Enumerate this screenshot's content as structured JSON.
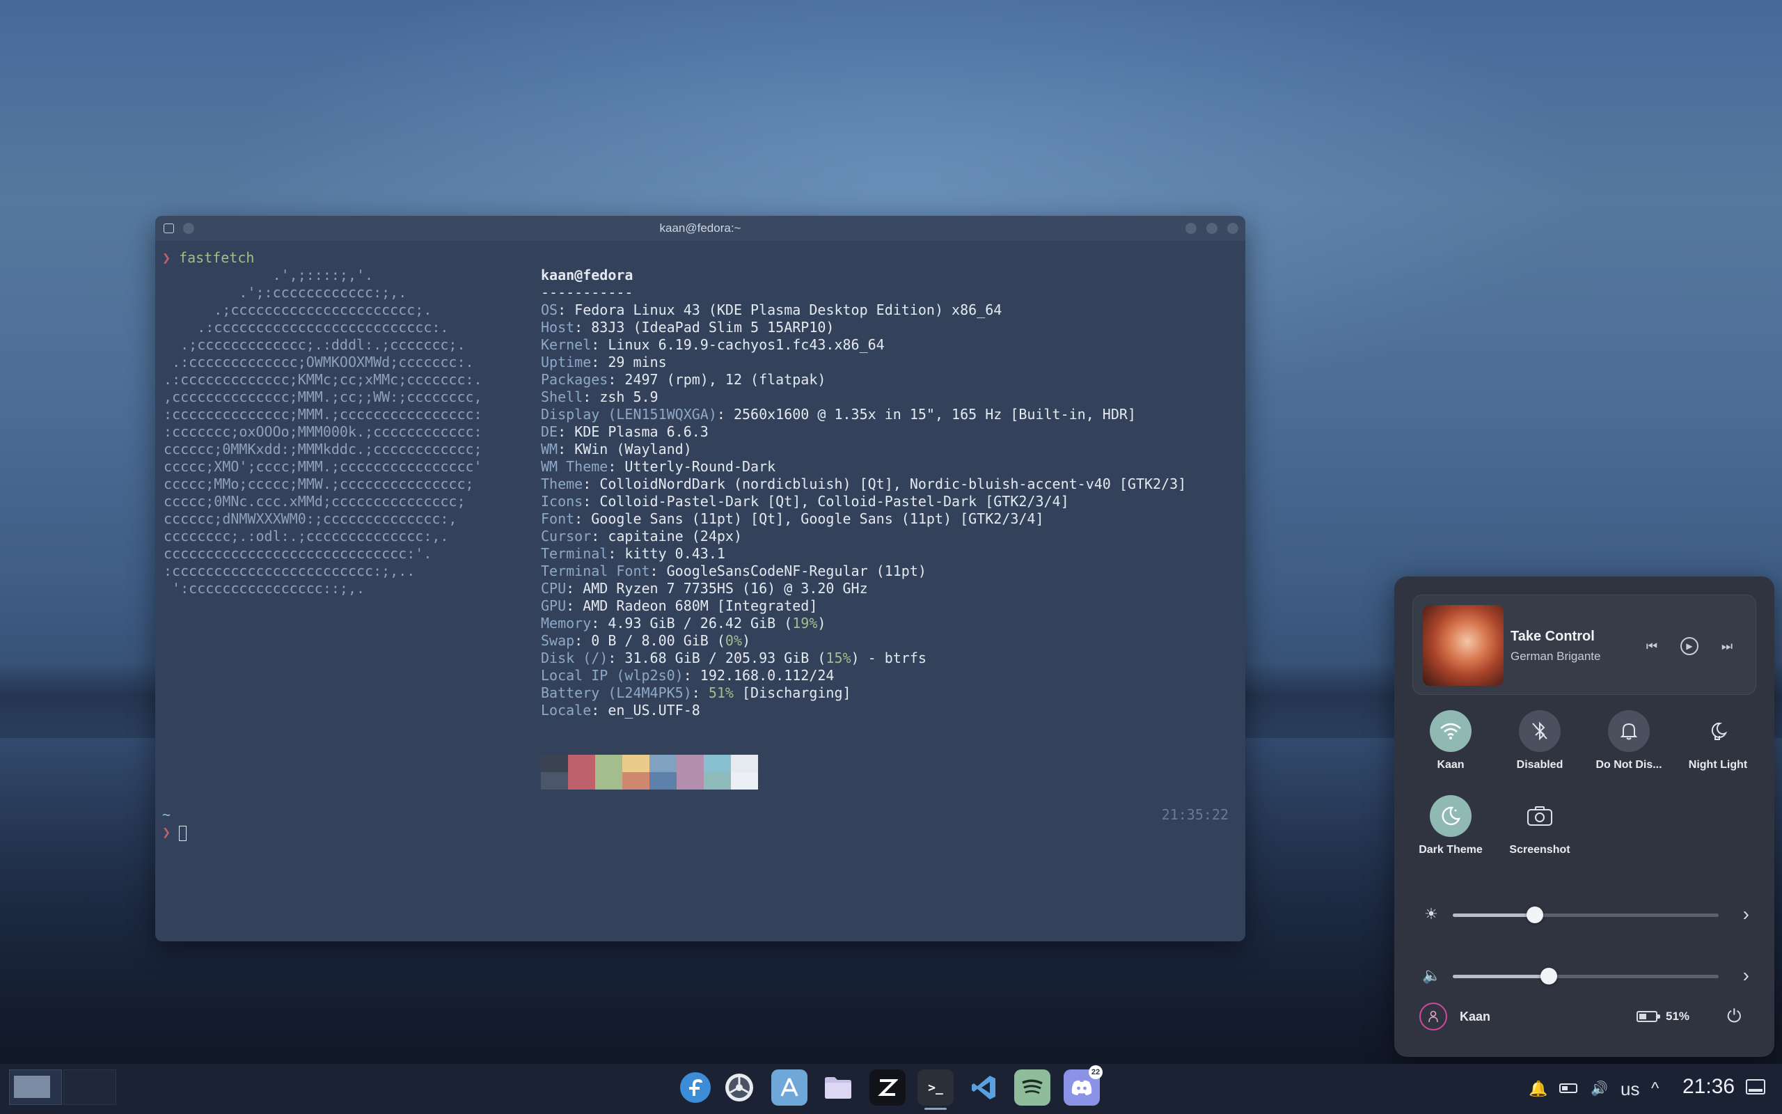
{
  "terminal": {
    "title": "kaan@fedora:~",
    "prompt_symbol": "❯",
    "command": "fastfetch",
    "user_host": "kaan@fedora",
    "separator": "-----------",
    "info": [
      {
        "key": "OS",
        "value": "Fedora Linux 43 (KDE Plasma Desktop Edition) x86_64"
      },
      {
        "key": "Host",
        "value": "83J3 (IdeaPad Slim 5 15ARP10)"
      },
      {
        "key": "Kernel",
        "value": "Linux 6.19.9-cachyos1.fc43.x86_64"
      },
      {
        "key": "Uptime",
        "value": "29 mins"
      },
      {
        "key": "Packages",
        "value": "2497 (rpm), 12 (flatpak)"
      },
      {
        "key": "Shell",
        "value": "zsh 5.9"
      },
      {
        "key": "Display (LEN151WQXGA)",
        "value": "2560x1600 @ 1.35x in 15\", 165 Hz [Built-in, HDR]"
      },
      {
        "key": "DE",
        "value": "KDE Plasma 6.6.3"
      },
      {
        "key": "WM",
        "value": "KWin (Wayland)"
      },
      {
        "key": "WM Theme",
        "value": "Utterly-Round-Dark"
      },
      {
        "key": "Theme",
        "value": "ColloidNordDark (nordicbluish) [Qt], Nordic-bluish-accent-v40 [GTK2/3]"
      },
      {
        "key": "Icons",
        "value": "Colloid-Pastel-Dark [Qt], Colloid-Pastel-Dark [GTK2/3/4]"
      },
      {
        "key": "Font",
        "value": "Google Sans (11pt) [Qt], Google Sans (11pt) [GTK2/3/4]"
      },
      {
        "key": "Cursor",
        "value": "capitaine (24px)"
      },
      {
        "key": "Terminal",
        "value": "kitty 0.43.1"
      },
      {
        "key": "Terminal Font",
        "value": "GoogleSansCodeNF-Regular (11pt)"
      },
      {
        "key": "CPU",
        "value": "AMD Ryzen 7 7735HS (16) @ 3.20 GHz"
      },
      {
        "key": "GPU",
        "value": "AMD Radeon 680M [Integrated]"
      },
      {
        "key": "Memory",
        "value": "4.93 GiB / 26.42 GiB (",
        "pct": "19%",
        "tail": ")"
      },
      {
        "key": "Swap",
        "value": "0 B / 8.00 GiB (",
        "pct": "0%",
        "tail": ")"
      },
      {
        "key": "Disk (/)",
        "value": "31.68 GiB / 205.93 GiB (",
        "pct": "15%",
        "tail": ") - btrfs"
      },
      {
        "key": "Local IP (wlp2s0)",
        "value": "192.168.0.112/24"
      },
      {
        "key": "Battery (L24M4PK5)",
        "value": " [Discharging]",
        "pct": "51%",
        "pct_first": true
      },
      {
        "key": "Locale",
        "value": "en_US.UTF-8"
      }
    ],
    "logo_lines": [
      "              .',;::::;,'.",
      "          .';:cccccccccccc:;,.",
      "       .;cccccccccccccccccccccc;.",
      "     .:cccccccccccccccccccccccccc:.",
      "   .;ccccccccccccc;.:dddl:.;ccccccc;.",
      "  .:ccccccccccccc;OWMKOOXMWd;ccccccc:.",
      " .:ccccccccccccc;KMMc;cc;xMMc;ccccccc:.",
      " ,cccccccccccccc;MMM.;cc;;WW:;cccccccc,",
      " :cccccccccccccc;MMM.;cccccccccccccccc:",
      " :ccccccc;oxOOOo;MMM000k.;cccccccccccc:",
      " cccccc;0MMKxdd:;MMMkddc.;cccccccccccc;",
      " ccccc;XMO';cccc;MMM.;cccccccccccccccc'",
      " ccccc;MMo;ccccc;MMW.;ccccccccccccccc;",
      " ccccc;0MNc.ccc.xMMd;ccccccccccccccc;",
      " cccccc;dNMWXXXWM0:;cccccccccccccc:,",
      " cccccccc;.:odl:.;cccccccccccccc:,.",
      " ccccccccccccccccccccccccccccc:'.",
      " :cccccccccccccccccccccccc:;,..",
      "  ':cccccccccccccccc::;,."
    ],
    "path_line": "~",
    "time": "21:35:22",
    "palette_top": [
      "#3b4252",
      "#bf616a",
      "#a3be8c",
      "#ebcb8b",
      "#81a1c1",
      "#b48ead",
      "#88c0d0",
      "#e5e9f0"
    ],
    "palette_bottom": [
      "#4c566a",
      "#bf616a",
      "#a3be8c",
      "#d08770",
      "#5e81ac",
      "#b48ead",
      "#8fbcbb",
      "#eceff4"
    ]
  },
  "media": {
    "title": "Take Control",
    "artist": "German Brigante",
    "prev_icon": "skip-previous-icon",
    "play_icon": "play-icon",
    "next_icon": "skip-next-icon"
  },
  "quick_tiles": [
    {
      "label": "Kaan",
      "icon": "wifi-icon",
      "active": true
    },
    {
      "label": "Disabled",
      "icon": "bluetooth-off-icon",
      "active": false
    },
    {
      "label": "Do Not Dis...",
      "icon": "bell-icon",
      "active": false
    },
    {
      "label": "Night Light",
      "icon": "night-light-icon",
      "active": false
    },
    {
      "label": "Dark Theme",
      "icon": "dark-theme-icon",
      "active": true
    },
    {
      "label": "Screenshot",
      "icon": "camera-icon",
      "active": false
    }
  ],
  "sliders": {
    "brightness": 0.31,
    "volume": 0.36
  },
  "user": {
    "name": "Kaan"
  },
  "battery": {
    "percent": "51%"
  },
  "taskbar": {
    "apps": [
      {
        "name": "fedora"
      },
      {
        "name": "system-monitor"
      },
      {
        "name": "app-store"
      },
      {
        "name": "files"
      },
      {
        "name": "zed"
      },
      {
        "name": "terminal",
        "glyph": ">_"
      },
      {
        "name": "vscode"
      },
      {
        "name": "spotify"
      },
      {
        "name": "discord",
        "badge": "22"
      }
    ],
    "keyboard_layout": "us",
    "clock": "21:36"
  },
  "colors": {
    "accent": "#8fb9b2",
    "terminal_bg": "#33415a",
    "panel_bg": "#2f3440",
    "taskbar_bg": "#1b2233"
  }
}
